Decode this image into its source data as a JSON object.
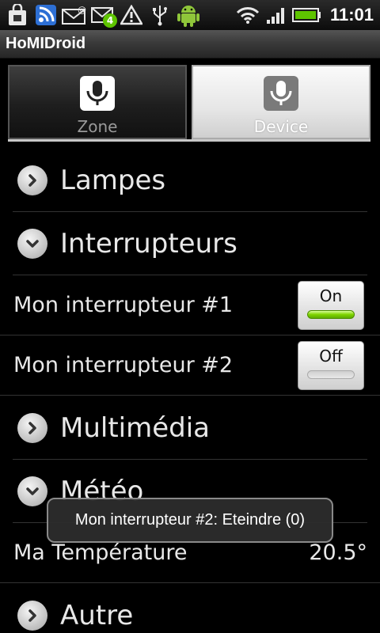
{
  "status_bar": {
    "time": "11:01",
    "icons": [
      "shopping-bag-icon",
      "rss-icon",
      "missed-email-icon",
      "email-notification-icon",
      "warning-icon",
      "usb-icon",
      "android-icon",
      "wifi-icon",
      "signal-icon",
      "battery-icon"
    ],
    "email_badge": "4",
    "accent_green": "#5ec400"
  },
  "app": {
    "title": "HoMIDroid"
  },
  "tabs": [
    {
      "label": "Zone",
      "selected": false
    },
    {
      "label": "Device",
      "selected": true
    }
  ],
  "list": {
    "lampes": {
      "label": "Lampes",
      "expanded": false
    },
    "interrupteurs": {
      "label": "Interrupteurs",
      "expanded": true
    },
    "switch1": {
      "label": "Mon interrupteur #1",
      "state": "On"
    },
    "switch2": {
      "label": "Mon interrupteur #2",
      "state": "Off"
    },
    "multimedia": {
      "label": "Multimédia",
      "expanded": false
    },
    "meteo": {
      "label": "Météo",
      "expanded": true
    },
    "temperature": {
      "label": "Ma Température",
      "value": "20.5°"
    },
    "autre": {
      "label": "Autre",
      "expanded": false
    }
  },
  "toast": {
    "message": "Mon interrupteur #2: Eteindre (0)"
  }
}
